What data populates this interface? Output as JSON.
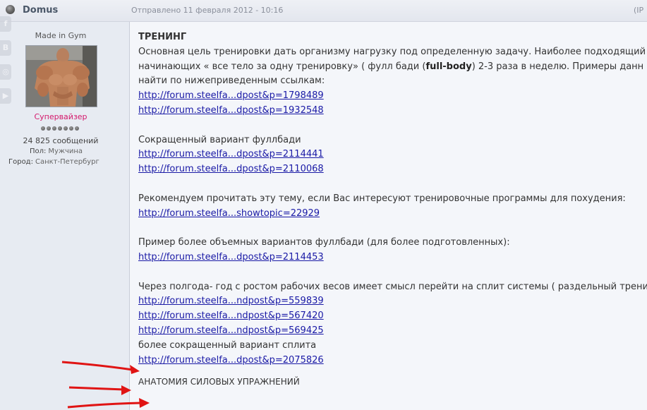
{
  "post": {
    "author": "Domus",
    "date": "Отправлено 11 февраля 2012 - 10:16",
    "ip_label": "(IP"
  },
  "profile": {
    "member_title": "Made in Gym",
    "group": "Супервайзер",
    "post_count": "24 825 сообщений",
    "gender_label": "Пол:",
    "gender_value": "Мужчина",
    "city_label": "Город:",
    "city_value": "Санкт-Петербург",
    "group_color": "#d4176b"
  },
  "social_icons": [
    "facebook-icon",
    "vk-icon",
    "instagram-icon",
    "youtube-icon"
  ],
  "content": {
    "heading": "ТРЕНИНГ",
    "intro_1": "Основная цель тренировки дать организму нагрузку под определенную задачу. Наиболее подходящий с",
    "intro_2_a": "начинающих « все тело за одну тренировку» ( фулл бади (",
    "intro_2_bold": "full-body",
    "intro_2_b": ") 2-3 раза в неделю. Примеры данн",
    "intro_3": "найти по нижеприведенным ссылкам:",
    "links_a": [
      "http://forum.steelfa...dpost&p=1798489",
      "http://forum.steelfa...dpost&p=1932548"
    ],
    "short_variant": "Сокращенный вариант фуллбади",
    "links_b": [
      "http://forum.steelfa...dpost&p=2114441",
      "http://forum.steelfa...dpost&p=2110068"
    ],
    "recommend": "Рекомендуем прочитать эту тему, если Вас интересуют тренировочные программы для похудения:",
    "link_c": "http://forum.steelfa...showtopic=22929",
    "bigger_variant": "Пример более объемных вариантов фуллбади (для более подготовленных):",
    "link_d": "http://forum.steelfa...dpost&p=2114453",
    "split_text": "Через полгода- год с ростом рабочих весов имеет смысл перейти на сплит системы ( раздельный трени",
    "links_e": [
      "http://forum.steelfa...ndpost&p=559839",
      "http://forum.steelfa...ndpost&p=567420",
      "http://forum.steelfa...ndpost&p=569425"
    ],
    "short_split": "более сокращенный вариант сплита",
    "link_f": "http://forum.steelfa...dpost&p=2075826",
    "anatomy": "АНАТОМИЯ СИЛОВЫХ УПРАЖНЕНИЙ"
  },
  "colors": {
    "link": "#1a1aa6",
    "arrow": "#e01414"
  }
}
